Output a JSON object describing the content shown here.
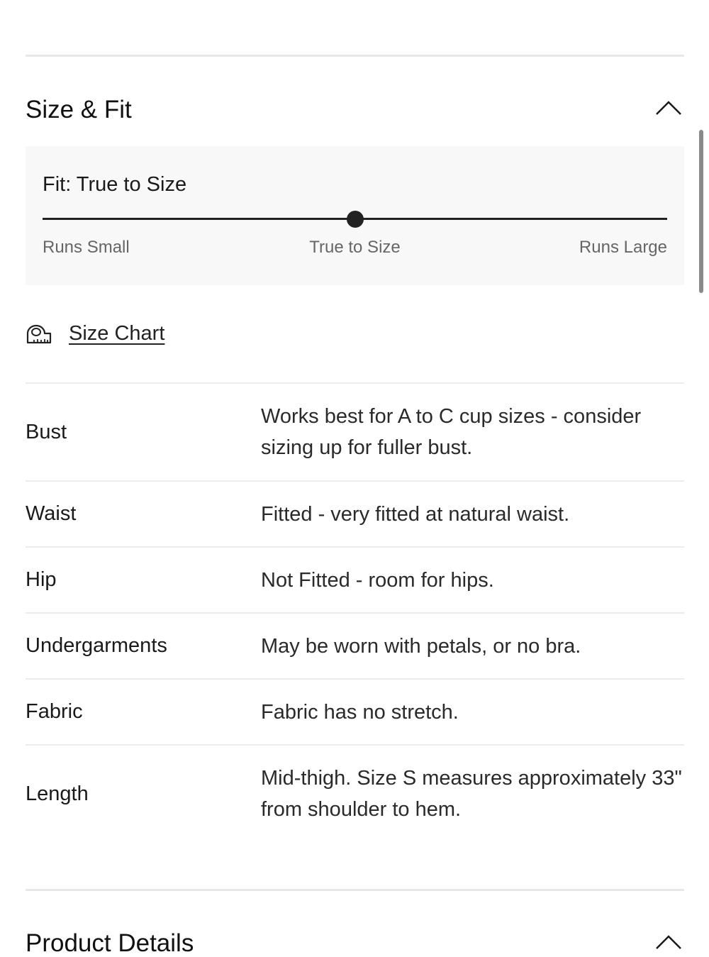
{
  "size_fit": {
    "title": "Size & Fit",
    "fit": {
      "title": "Fit: True to Size",
      "position": 0.5,
      "scale_labels": [
        "Runs Small",
        "True to Size",
        "Runs Large"
      ]
    },
    "size_chart_link": {
      "label": "Size Chart",
      "icon": "measuring-tape-icon"
    },
    "rows": [
      {
        "attribute": "Bust",
        "description": "Works best for A to C cup sizes - consider sizing up for fuller bust."
      },
      {
        "attribute": "Waist",
        "description": "Fitted - very fitted at natural waist."
      },
      {
        "attribute": "Hip",
        "description": "Not Fitted - room for hips."
      },
      {
        "attribute": "Undergarments",
        "description": "May be worn with petals, or no bra."
      },
      {
        "attribute": "Fabric",
        "description": "Fabric has no stretch."
      },
      {
        "attribute": "Length",
        "description": "Mid-thigh. Size S measures approximately 33\" from shoulder to hem."
      }
    ]
  },
  "product_details": {
    "title": "Product Details"
  },
  "icons": {
    "collapse_size_fit": "chevron-up-icon",
    "collapse_product_details": "chevron-up-icon"
  },
  "colors": {
    "panel_background": "#f8f8f8",
    "slider": "#222222",
    "divider": "#e8e8e8"
  }
}
